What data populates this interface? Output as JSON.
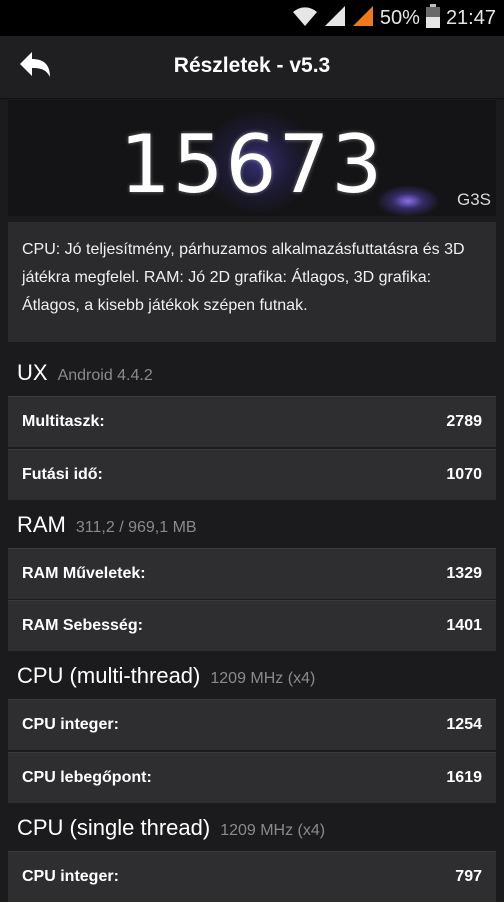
{
  "status_bar": {
    "battery_percent": "50%",
    "time": "21:47",
    "icons": [
      "wifi-icon",
      "signal-icon",
      "signal-orange-icon",
      "battery-icon"
    ]
  },
  "app_bar": {
    "back_icon": "back-arrow-icon",
    "title": "Részletek - v5.3"
  },
  "score": {
    "value": "15673",
    "device": "G3S"
  },
  "description": "CPU: Jó teljesítmény, párhuzamos alkalmazásfuttatásra és 3D játékra megfelel. RAM: Jó 2D grafika: Átlagos, 3D grafika: Átlagos, a kisebb játékok szépen futnak.",
  "sections": [
    {
      "title": "UX",
      "subtitle": "Android 4.4.2",
      "rows": [
        {
          "label": "Multitaszk:",
          "value": "2789"
        },
        {
          "label": "Futási idő:",
          "value": "1070"
        }
      ]
    },
    {
      "title": "RAM",
      "subtitle": "311,2 / 969,1 MB",
      "rows": [
        {
          "label": "RAM Műveletek:",
          "value": "1329"
        },
        {
          "label": "RAM Sebesség:",
          "value": "1401"
        }
      ]
    },
    {
      "title": "CPU (multi-thread)",
      "subtitle": "1209 MHz (x4)",
      "rows": [
        {
          "label": "CPU integer:",
          "value": "1254"
        },
        {
          "label": "CPU lebegőpont:",
          "value": "1619"
        }
      ]
    },
    {
      "title": "CPU (single thread)",
      "subtitle": "1209 MHz (x4)",
      "rows": [
        {
          "label": "CPU integer:",
          "value": "797"
        }
      ]
    }
  ],
  "colors": {
    "background": "#1b1b1d",
    "row_bg": "#2e2e31",
    "signal_accent": "#f07a1a"
  }
}
